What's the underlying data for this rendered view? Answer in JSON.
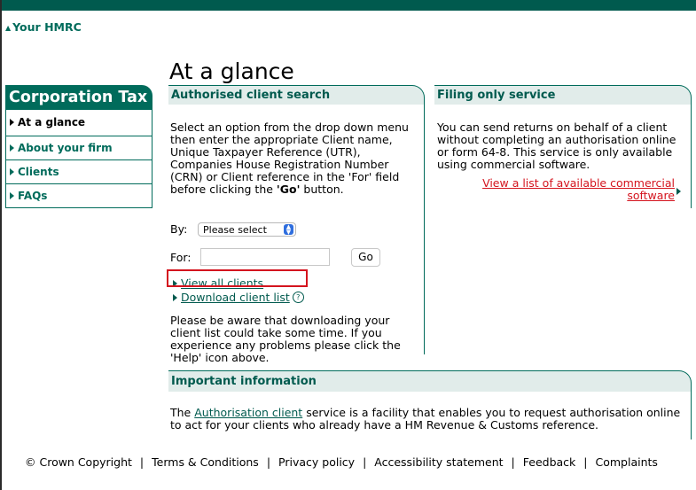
{
  "header": {
    "your_hmrc": "Your HMRC"
  },
  "page_title": "At a glance",
  "nav": {
    "title": "Corporation Tax",
    "items": [
      {
        "label": "At a glance",
        "active": true
      },
      {
        "label": "About your firm"
      },
      {
        "label": "Clients"
      },
      {
        "label": "FAQs"
      }
    ]
  },
  "search_panel": {
    "title": "Authorised client search",
    "intro_a": "Select an option from the drop down menu then enter the appropriate Client name, Unique Taxpayer Reference (UTR), Companies House Registration Number (CRN) or Client reference in the 'For' field before clicking the ",
    "intro_go": "'Go'",
    "intro_b": " button.",
    "by_label": "By:",
    "select_value": "Please select",
    "for_label": "For:",
    "go_label": "Go",
    "view_all": "View all clients",
    "download": "Download client list",
    "help_glyph": "?",
    "warning": "Please be aware that downloading your client list could take some time. If you experience any problems please click the 'Help' icon above."
  },
  "filing_panel": {
    "title": "Filing only service",
    "text": "You can send returns on behalf of a client without completing an authorisation online or form 64-8. This service is only available using commercial software.",
    "link": "View a list of available commercial software"
  },
  "info_panel": {
    "title": "Important information",
    "text_a": "The ",
    "link": "Authorisation client",
    "text_b": " service is a facility that enables you to request authorisation online to act for your clients who already have a HM Revenue & Customs reference."
  },
  "footer": {
    "copyright": "© Crown Copyright",
    "links": [
      "Terms & Conditions",
      "Privacy policy",
      "Accessibility statement",
      "Feedback",
      "Complaints"
    ]
  },
  "colors": {
    "brand": "#006b5b",
    "panel_bg": "#e1ecea",
    "alert": "#d4141e"
  }
}
